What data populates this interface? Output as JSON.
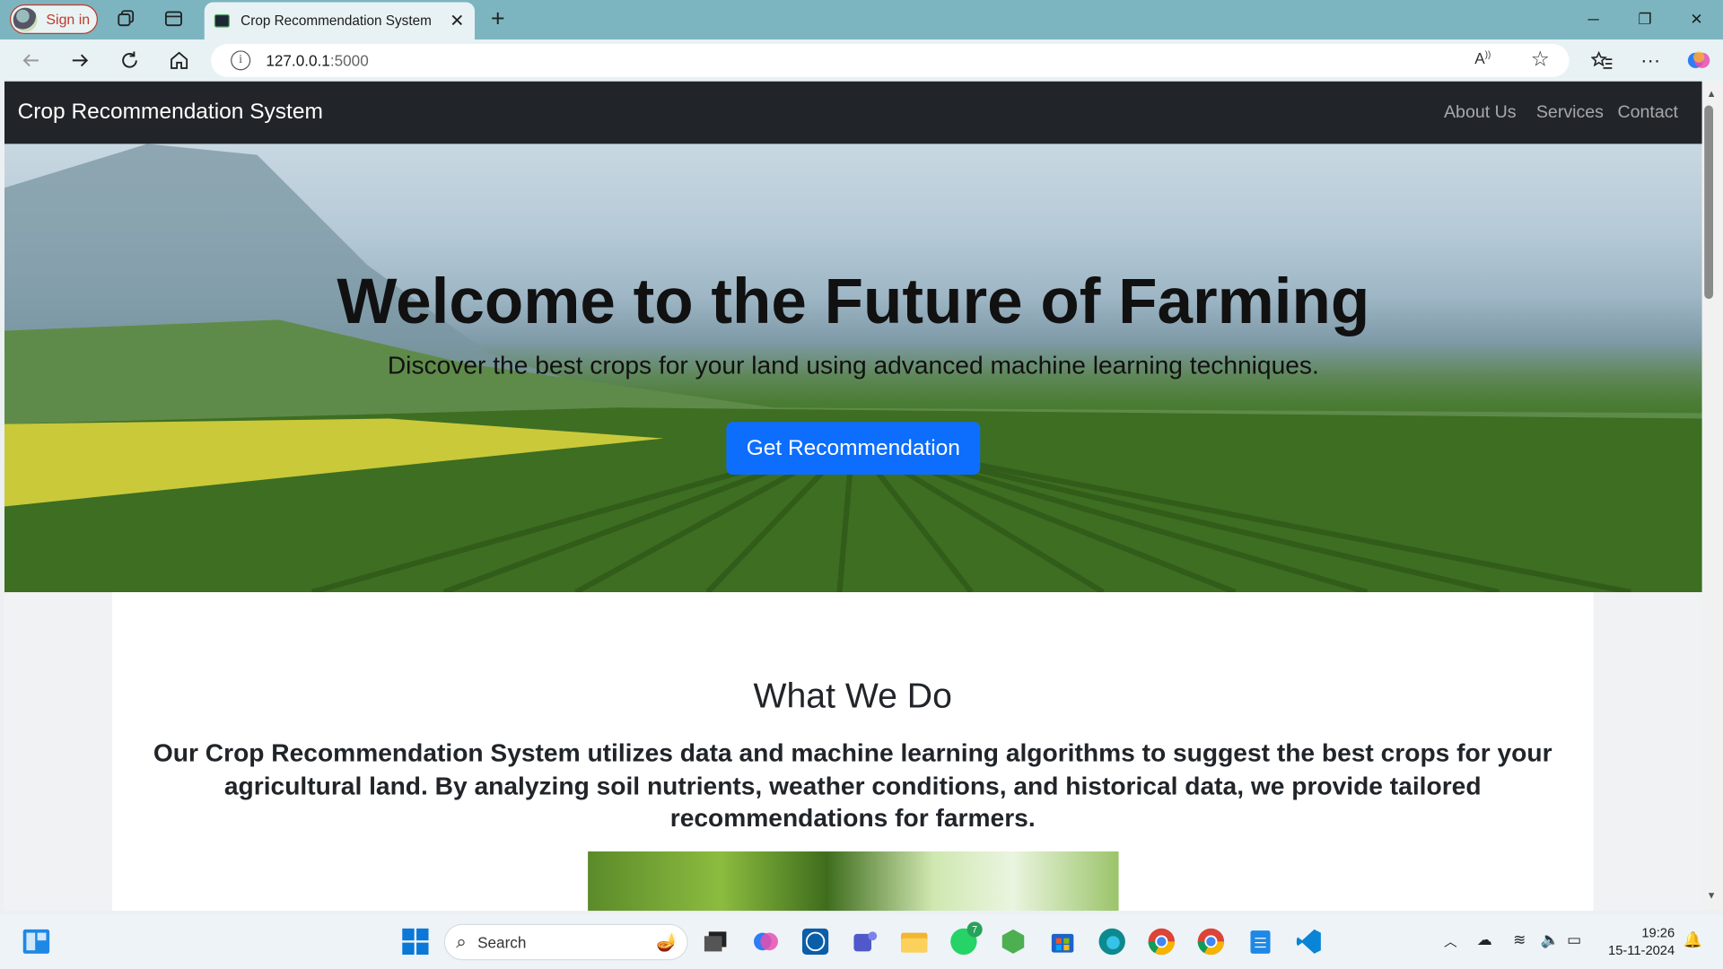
{
  "browser": {
    "signin_label": "Sign in",
    "tab_title": "Crop Recommendation System",
    "url_host": "127.0.0.1",
    "url_port": ":5000"
  },
  "site": {
    "brand": "Crop Recommendation System",
    "nav": [
      "About Us",
      "Services",
      "Contact"
    ],
    "hero": {
      "title": "Welcome to the Future of Farming",
      "subtitle": "Discover the best crops for your land using advanced machine learning techniques.",
      "cta": "Get Recommendation"
    },
    "section": {
      "title": "What We Do",
      "body": "Our Crop Recommendation System utilizes data and machine learning algorithms to suggest the best crops for your agricultural land. By analyzing soil nutrients, weather conditions, and historical data, we provide tailored recommendations for farmers."
    }
  },
  "taskbar": {
    "search_placeholder": "Search",
    "whatsapp_badge": "7",
    "time": "19:26",
    "date": "15-11-2024"
  },
  "colors": {
    "navbar": "#212529",
    "primary": "#0d6efd",
    "tabbar": "#7cb5c0"
  }
}
